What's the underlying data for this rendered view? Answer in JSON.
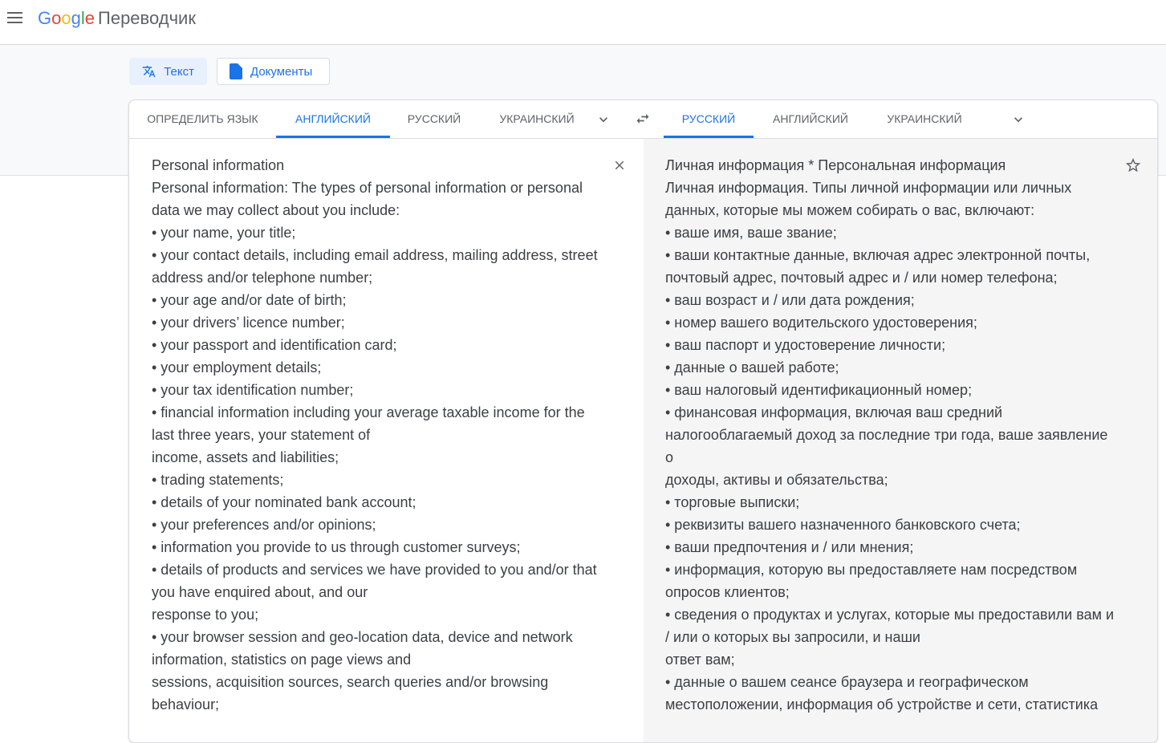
{
  "header": {
    "logo_letters": [
      "G",
      "o",
      "o",
      "g",
      "l",
      "e"
    ],
    "logo_colors": [
      "#4285f4",
      "#ea4335",
      "#fbbc05",
      "#4285f4",
      "#34a853",
      "#ea4335"
    ],
    "app_name": "Переводчик"
  },
  "modes": {
    "text": "Текст",
    "documents": "Документы"
  },
  "source_tabs": [
    "ОПРЕДЕЛИТЬ ЯЗЫК",
    "АНГЛИЙСКИЙ",
    "РУССКИЙ",
    "УКРАИНСКИЙ"
  ],
  "target_tabs": [
    "РУССКИЙ",
    "АНГЛИЙСКИЙ",
    "УКРАИНСКИЙ"
  ],
  "source_text": "Personal information\nPersonal information: The types of personal information or personal data we may collect about you include:\n• your name, your title;\n• your contact details, including email address, mailing address, street address and/or telephone number;\n• your age and/or date of birth;\n• your drivers’ licence number;\n• your passport and identification card;\n• your employment details;\n• your tax identification number;\n• financial information including your average taxable income for the last three years, your statement of\nincome, assets and liabilities;\n• trading statements;\n• details of your nominated bank account;\n• your preferences and/or opinions;\n• information you provide to us through customer surveys;\n• details of products and services we have provided to you and/or that you have enquired about, and our\nresponse to you;\n• your browser session and geo-location data, device and network information, statistics on page views and\nsessions, acquisition sources, search queries and/or browsing behaviour;",
  "translated_text": "Личная информация * Персональная информация\nЛичная информация. Типы личной информации или личных данных, которые мы можем собирать о вас, включают:\n• ваше имя, ваше звание;\n• ваши контактные данные, включая адрес электронной почты, почтовый адрес, почтовый адрес и / или номер телефона;\n• ваш возраст и / или дата рождения;\n• номер вашего водительского удостоверения;\n• ваш паспорт и удостоверение личности;\n• данные о вашей работе;\n• ваш налоговый идентификационный номер;\n• финансовая информация, включая ваш средний налогооблагаемый доход за последние три года, ваше заявление о\nдоходы, активы и обязательства;\n• торговые выписки;\n• реквизиты вашего назначенного банковского счета;\n• ваши предпочтения и / или мнения;\n• информация, которую вы предоставляете нам посредством опросов клиентов;\n• сведения о продуктах и услугах, которые мы предоставили вам и / или о которых вы запросили, и наши\nответ вам;\n• данные о вашем сеансе браузера и географическом местоположении, информация об устройстве и сети, статистика"
}
